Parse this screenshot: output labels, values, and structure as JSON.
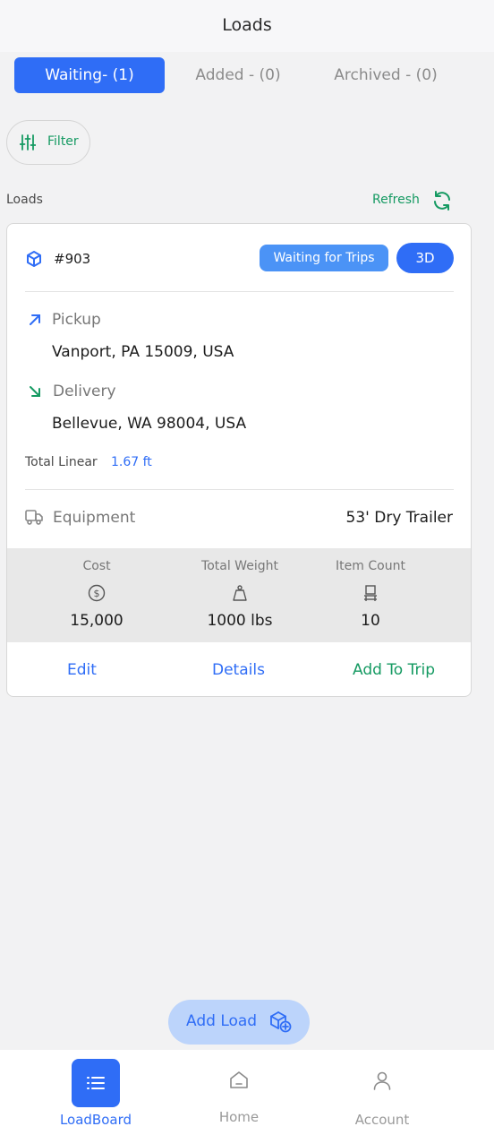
{
  "header": {
    "title": "Loads"
  },
  "tabs": [
    {
      "label": "Waiting- (1)",
      "active": true
    },
    {
      "label": "Added - (0)",
      "active": false
    },
    {
      "label": "Archived - (0)",
      "active": false
    }
  ],
  "filter": {
    "label": "Filter",
    "icon": "sliders-icon"
  },
  "list": {
    "section_label": "Loads",
    "refresh_label": "Refresh",
    "refresh_icon": "refresh-icon"
  },
  "card": {
    "id": "#903",
    "status": "Waiting for Trips",
    "view_3d_label": "3D",
    "pickup": {
      "label": "Pickup",
      "address": "Vanport, PA 15009, USA"
    },
    "delivery": {
      "label": "Delivery",
      "address": "Bellevue, WA 98004, USA"
    },
    "total_linear": {
      "label": "Total Linear",
      "value": "1.67 ft"
    },
    "equipment": {
      "label": "Equipment",
      "value": "53' Dry Trailer"
    },
    "stats": [
      {
        "label": "Cost",
        "value": "15,000",
        "icon": "dollar-icon"
      },
      {
        "label": "Total Weight",
        "value": "1000 lbs",
        "icon": "weight-icon"
      },
      {
        "label": "Item Count",
        "value": "10",
        "icon": "pallet-icon"
      }
    ],
    "actions": {
      "edit": "Edit",
      "details": "Details",
      "add_to_trip": "Add To Trip"
    }
  },
  "add_load": {
    "label": "Add Load",
    "icon": "box-plus-icon"
  },
  "bottom_nav": [
    {
      "label": "LoadBoard",
      "icon": "list-icon",
      "active": true
    },
    {
      "label": "Home",
      "icon": "home-icon",
      "active": false
    },
    {
      "label": "Account",
      "icon": "user-icon",
      "active": false
    }
  ],
  "colors": {
    "primary": "#2f6df6",
    "badge": "#4b93f6",
    "green": "#159a62",
    "background": "#f2f2f3"
  }
}
